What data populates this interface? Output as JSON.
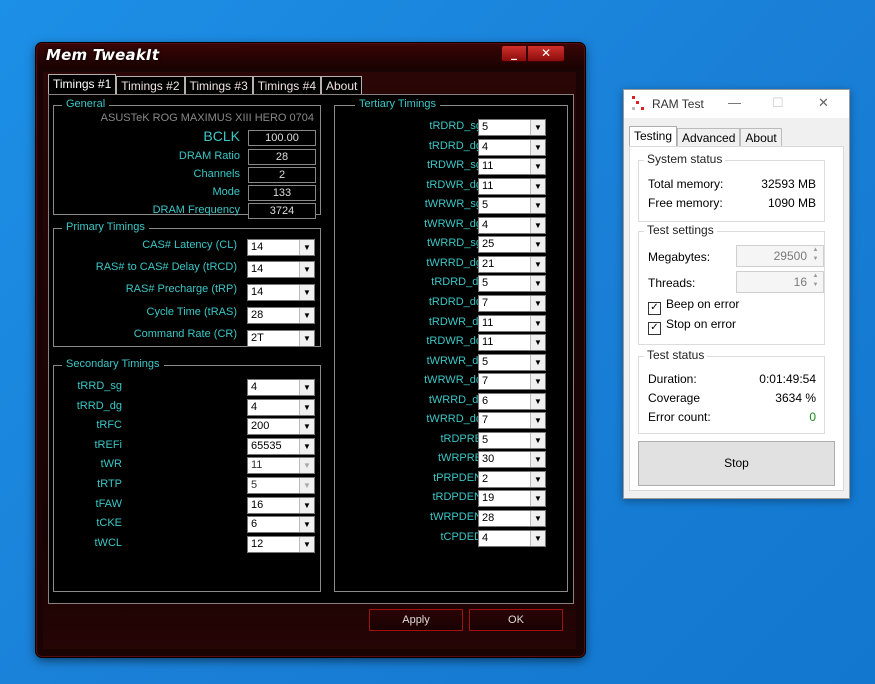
{
  "memtweakit": {
    "title": "Mem TweakIt",
    "min_label": "_",
    "close_label": "✕",
    "tabs": [
      "Timings #1",
      "Timings #2",
      "Timings #3",
      "Timings #4",
      "About"
    ],
    "general": {
      "title": "General",
      "board": "ASUSTeK ROG MAXIMUS XIII HERO 0704",
      "rows": [
        {
          "label": "BCLK",
          "value": "100.00"
        },
        {
          "label": "DRAM Ratio",
          "value": "28"
        },
        {
          "label": "Channels",
          "value": "2"
        },
        {
          "label": "Mode",
          "value": "133"
        },
        {
          "label": "DRAM Frequency",
          "value": "3724"
        }
      ]
    },
    "primary": {
      "title": "Primary Timings",
      "rows": [
        {
          "label": "CAS# Latency (CL)",
          "value": "14"
        },
        {
          "label": "RAS# to CAS# Delay (tRCD)",
          "value": "14"
        },
        {
          "label": "RAS# Precharge (tRP)",
          "value": "14"
        },
        {
          "label": "Cycle Time (tRAS)",
          "value": "28"
        },
        {
          "label": "Command Rate (CR)",
          "value": "2T"
        }
      ]
    },
    "secondary": {
      "title": "Secondary Timings",
      "rows": [
        {
          "label": "tRRD_sg",
          "value": "4"
        },
        {
          "label": "tRRD_dg",
          "value": "4"
        },
        {
          "label": "tRFC",
          "value": "200"
        },
        {
          "label": "tREFi",
          "value": "65535"
        },
        {
          "label": "tWR",
          "value": "11"
        },
        {
          "label": "tRTP",
          "value": "5"
        },
        {
          "label": "tFAW",
          "value": "16"
        },
        {
          "label": "tCKE",
          "value": "6"
        },
        {
          "label": "tWCL",
          "value": "12"
        }
      ]
    },
    "tertiary": {
      "title": "Tertiary Timings",
      "rows": [
        {
          "label": "tRDRD_sg",
          "value": "5"
        },
        {
          "label": "tRDRD_dg",
          "value": "4"
        },
        {
          "label": "tRDWR_sg",
          "value": "11"
        },
        {
          "label": "tRDWR_dg",
          "value": "11"
        },
        {
          "label": "tWRWR_sg",
          "value": "5"
        },
        {
          "label": "tWRWR_dg",
          "value": "4"
        },
        {
          "label": "tWRRD_sg",
          "value": "25"
        },
        {
          "label": "tWRRD_dg",
          "value": "21"
        },
        {
          "label": "tRDRD_dr",
          "value": "5"
        },
        {
          "label": "tRDRD_dd",
          "value": "7"
        },
        {
          "label": "tRDWR_dr",
          "value": "11"
        },
        {
          "label": "tRDWR_dd",
          "value": "11"
        },
        {
          "label": "tWRWR_dr",
          "value": "5"
        },
        {
          "label": "tWRWR_dd",
          "value": "7"
        },
        {
          "label": "tWRRD_dr",
          "value": "6"
        },
        {
          "label": "tWRRD_dd",
          "value": "7"
        },
        {
          "label": "tRDPRE",
          "value": "5"
        },
        {
          "label": "tWRPRE",
          "value": "30"
        },
        {
          "label": "tPRPDEN",
          "value": "2"
        },
        {
          "label": "tRDPDEN",
          "value": "19"
        },
        {
          "label": "tWRPDEN",
          "value": "28"
        },
        {
          "label": "tCPDED",
          "value": "4"
        }
      ]
    },
    "apply_label": "Apply",
    "ok_label": "OK"
  },
  "ramtest": {
    "title": "RAM Test",
    "min_label": "—",
    "max_label": "☐",
    "close_label": "✕",
    "tabs": [
      "Testing",
      "Advanced",
      "About"
    ],
    "system_status": {
      "title": "System status",
      "total_label": "Total memory:",
      "total_value": "32593 MB",
      "free_label": "Free memory:",
      "free_value": "1090 MB"
    },
    "test_settings": {
      "title": "Test settings",
      "megabytes_label": "Megabytes:",
      "megabytes_value": "29500",
      "threads_label": "Threads:",
      "threads_value": "16",
      "beep_label": "Beep on error",
      "stop_label": "Stop on error",
      "check_glyph": "✓"
    },
    "test_status": {
      "title": "Test status",
      "duration_label": "Duration:",
      "duration_value": "0:01:49:54",
      "coverage_label": "Coverage",
      "coverage_value": "3634 %",
      "errors_label": "Error count:",
      "errors_value": "0"
    },
    "stop_button": "Stop",
    "colors": {
      "error_count": "#1a8a1a",
      "accent": "#3cc6c6"
    }
  }
}
